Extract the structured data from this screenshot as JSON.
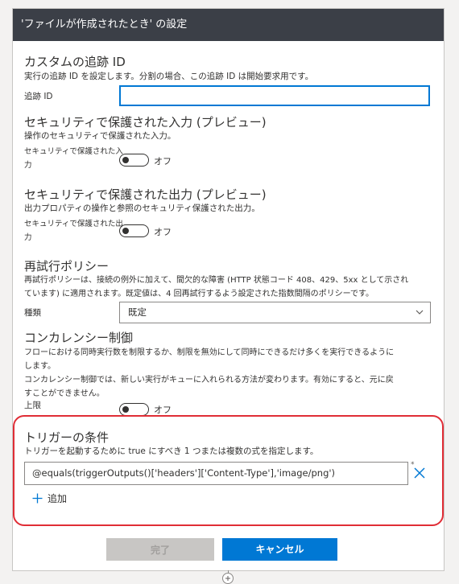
{
  "dialog": {
    "title": "'ファイルが作成されたとき' の設定"
  },
  "tracking": {
    "title": "カスタムの追跡 ID",
    "description": "実行の追跡 ID を設定します。分割の場合、この追跡 ID は開始要求用です。",
    "label": "追跡 ID",
    "value": ""
  },
  "secure_input": {
    "title": "セキュリティで保護された入力 (プレビュー)",
    "description": "操作のセキュリティで保護された入力。",
    "label_line1": "セキュリティで保護された入",
    "label_line2": "力",
    "toggle_state": "オフ"
  },
  "secure_output": {
    "title": "セキュリティで保護された出力 (プレビュー)",
    "description": "出力プロパティの操作と参照のセキュリティ保護された出力。",
    "label_line1": "セキュリティで保護された出",
    "label_line2": "力",
    "toggle_state": "オフ"
  },
  "retry": {
    "title": "再試行ポリシー",
    "description_line1": "再試行ポリシーは、接続の例外に加えて、間欠的な障害 (HTTP 状態コード 408、429、5xx として示され",
    "description_line2": "ています) に適用されます。既定値は、4 回再試行するよう設定された指数間隔のポリシーです。",
    "type_label": "種類",
    "type_value": "既定"
  },
  "concurrency": {
    "title": "コンカレンシー制御",
    "description_line1": "フローにおける同時実行数を制限するか、制限を無効にして同時にできるだけ多くを実行できるように",
    "description_line2": "します。",
    "description_line3": "コンカレンシー制御では、新しい実行がキューに入れられる方法が変わります。有効にすると、元に戻",
    "description_line4": "すことができません。",
    "limit_label": "上限",
    "toggle_state": "オフ"
  },
  "trigger": {
    "title": "トリガーの条件",
    "description": "トリガーを起動するために true にすべき 1 つまたは複数の式を指定します。",
    "expression": "@equals(triggerOutputs()['headers']['Content-Type'],'image/png')",
    "required_mark": "*",
    "add_label": "追加"
  },
  "footer": {
    "done_label": "完了",
    "cancel_label": "キャンセル"
  },
  "icons": {
    "remove": "close-icon",
    "add": "plus-icon",
    "dropdown": "chevron-down-icon",
    "connector": "plus-circle-icon"
  },
  "colors": {
    "header_bg": "#3b3f47",
    "accent": "#0078d4",
    "highlight_border": "#e02d36",
    "disabled": "#c8c6c4"
  }
}
